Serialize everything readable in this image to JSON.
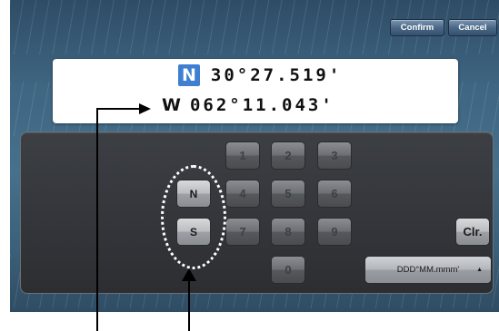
{
  "toolbar": {
    "confirm_label": "Confirm",
    "cancel_label": "Cancel"
  },
  "coordinates": {
    "latitude": {
      "hemisphere": "N",
      "value": "30°27.519'"
    },
    "longitude": {
      "hemisphere": "W",
      "value": "062°11.043'"
    }
  },
  "keypad": {
    "digits": [
      "1",
      "2",
      "3",
      "4",
      "5",
      "6",
      "7",
      "8",
      "9",
      "0"
    ],
    "hemisphere_keys": [
      "N",
      "S"
    ],
    "clear_label": "Clr.",
    "format": {
      "selected": "DDD°MM.mmm'"
    }
  },
  "colors": {
    "active_hemisphere": "#3f7fd2",
    "panel": "#2c2e32",
    "background": "#3f6682"
  }
}
